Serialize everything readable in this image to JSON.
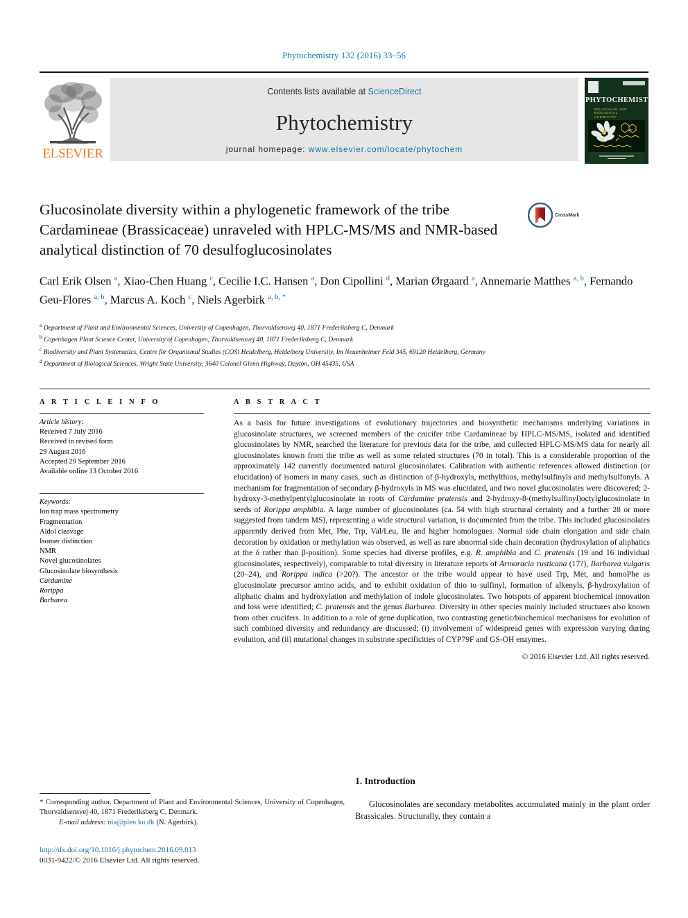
{
  "running_head": "Phytochemistry 132 (2016) 33–56",
  "masthead": {
    "publisher_logo_label": "ELSEVIER",
    "contents_prefix": "Contents lists available at ",
    "contents_link": "ScienceDirect",
    "journal_name": "Phytochemistry",
    "homepage_prefix": "journal homepage: ",
    "homepage_url": "www.elsevier.com/locate/phytochem",
    "cover": {
      "title": "PHYTOCHEMISTRY",
      "subtitle": "MOLECULAR AND\nBIOLOGICAL\nCHEMISTRY"
    }
  },
  "article": {
    "title": "Glucosinolate diversity within a phylogenetic framework of the tribe Cardamineae (Brassicaceae) unraveled with HPLC-MS/MS and NMR-based analytical distinction of 70 desulfoglucosinolates",
    "crossmark_label": "CrossMark",
    "authors_html": "Carl Erik Olsen <sup>a</sup>, Xiao-Chen Huang <sup>c</sup>, Cecilie I.C. Hansen <sup>a</sup>, Don Cipollini <sup>d</sup>, Marian Ørgaard <sup>a</sup>, Annemarie Matthes <sup>a, b</sup>, Fernando Geu-Flores <sup>a, b</sup>, Marcus A. Koch <sup>c</sup>, Niels Agerbirk <sup>a, b, *</sup>",
    "affiliations": [
      {
        "mark": "a",
        "text": "Department of Plant and Environmental Sciences, University of Copenhagen, Thorvaldsensvej 40, 1871 Frederiksberg C, Denmark"
      },
      {
        "mark": "b",
        "text": "Copenhagen Plant Science Center, University of Copenhagen, Thorvaldsensvej 40, 1871 Frederiksberg C, Denmark"
      },
      {
        "mark": "c",
        "text": "Biodiversity and Plant Systematics, Centre for Organismal Studies (COS) Heidelberg, Heidelberg University, Im Neuenheimer Feld 345, 69120 Heidelberg, Germany"
      },
      {
        "mark": "d",
        "text": "Department of Biological Sciences, Wright State University, 3640 Colonel Glenn Highway, Dayton, OH 45435, USA"
      }
    ]
  },
  "article_info": {
    "heading": "A R T I C L E   I N F O",
    "history_label": "Article history:",
    "history": [
      "Received 7 July 2016",
      "Received in revised form",
      "29 August 2016",
      "Accepted 29 September 2016",
      "Available online 13 October 2016"
    ],
    "keywords_label": "Keywords:",
    "keywords": [
      {
        "text": "Ion trap mass spectrometry",
        "italic": false
      },
      {
        "text": "Fragmentation",
        "italic": false
      },
      {
        "text": "Aldol cleavage",
        "italic": false
      },
      {
        "text": "Isomer distinction",
        "italic": false
      },
      {
        "text": "NMR",
        "italic": false
      },
      {
        "text": "Novel glucosinolates",
        "italic": false
      },
      {
        "text": "Glucosinolate biosynthesis",
        "italic": false
      },
      {
        "text": "Cardamine",
        "italic": true
      },
      {
        "text": "Rorippa",
        "italic": true
      },
      {
        "text": "Barbarea",
        "italic": true
      }
    ]
  },
  "abstract": {
    "heading": "A B S T R A C T",
    "body_html": "As a basis for future investigations of evolutionary trajectories and biosynthetic mechanisms underlying variations in glucosinolate structures, we screened members of the crucifer tribe Cardamineae by HPLC-MS/MS, isolated and identified glucosinolates by NMR, searched the literature for previous data for the tribe, and collected HPLC-MS/MS data for nearly all glucosinolates known from the tribe as well as some related structures (70 in total). This is a considerable proportion of the approximately 142 currently documented natural glucosinolates. Calibration with authentic references allowed distinction (or elucidation) of isomers in many cases, such as distinction of &beta;-hydroxyls, methylthios, methylsulfinyls and methylsulfonyls. A mechanism for fragmentation of secondary &beta;-hydroxyls in MS was elucidated, and two novel glucosinolates were discovered; 2-hydroxy-3-methylpentylglucosinolate in roots of <i>Cardamine pratensis</i> and 2-hydroxy-8-(methylsulfinyl)octylglucosinolate in seeds of <i>Rorippa amphibia</i>. A large number of glucosinolates (ca. 54 with high structural certainty and a further 28 or more suggested from tandem MS), representing a wide structural variation, is documented from the tribe. This included glucosinolates apparently derived from Met, Phe, Trp, Val/Leu, Ile and higher homologues. Normal side chain elongation and side chain decoration by oxidation or methylation was observed, as well as rare abnormal side chain decoration (hydroxylation of aliphatics at the &delta; rather than &beta;-position). Some species had diverse profiles, e.g. <i>R. amphibia</i> and <i>C. pratensis</i> (19 and 16 individual glucosinolates, respectively), comparable to total diversity in literature reports of <i>Armoracia rusticana</i> (17?), <i>Barbarea vulgaris</i> (20&ndash;24), and <i>Rorippa indica</i> (&gt;20?). The ancestor or the tribe would appear to have used Trp, Met, and homoPhe as glucosinolate precursor amino acids, and to exhibit oxidation of thio to sulfinyl, formation of alkenyls, &beta;-hydroxylation of aliphatic chains and hydroxylation and methylation of indole glucosinolates. Two hotspots of apparent biochemical innovation and loss were identified; <i>C. pratensis</i> and the genus <i>Barbarea</i>. Diversity in other species mainly included structures also known from other crucifers. In addition to a role of gene duplication, two contrasting genetic/biochemical mechanisms for evolution of such combined diversity and redundancy are discussed; (i) involvement of widespread genes with expression varying during evolution, and (ii) mutational changes in substrate specificities of CYP79F and GS-OH enzymes.",
    "copyright": "© 2016 Elsevier Ltd. All rights reserved."
  },
  "footnote": {
    "text_html": "* Corresponding author. Department of Plant and Environmental Sciences, University of Copenhagen, Thorvaldsensvej 40, 1871 Frederiksberg C, Denmark.",
    "email_label": "E-mail address:",
    "email": "nia@plen.ku.dk",
    "email_suffix": "(N. Agerbirk)."
  },
  "doi": {
    "link": "http://dx.doi.org/10.1016/j.phytochem.2016.09.013",
    "issn_line": "0031-9422/© 2016 Elsevier Ltd. All rights reserved."
  },
  "introduction": {
    "heading": "1. Introduction",
    "paragraph": "Glucosinolates are secondary metabolites accumulated mainly in the plant order Brassicales. Structurally, they contain a"
  },
  "colors": {
    "link": "#1a6fa8",
    "running_head": "#0b7eb4",
    "elsevier_orange": "#e87722",
    "cover_green": "#13301c",
    "crossmark_red": "#b2281f"
  }
}
